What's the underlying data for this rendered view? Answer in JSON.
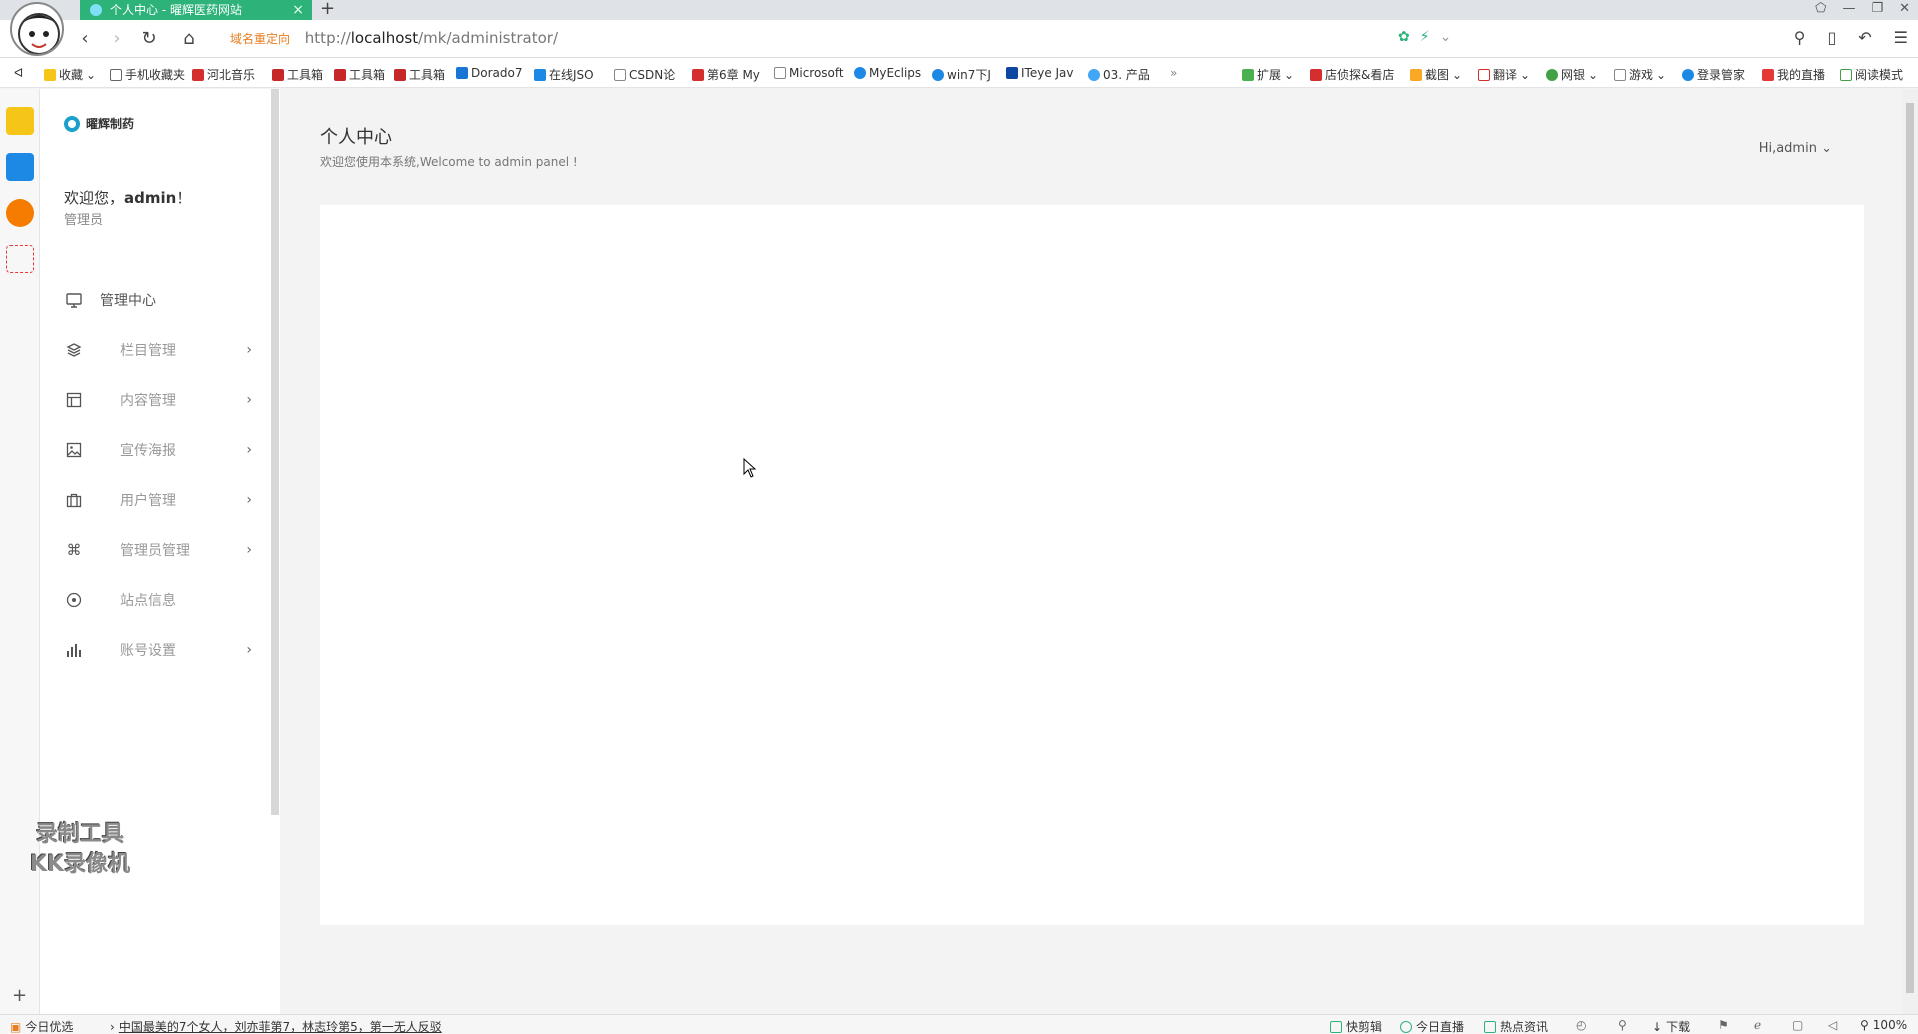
{
  "browser": {
    "tab_title": "个人中心 - 曜辉医药网站",
    "redirect_label": "域名重定向",
    "url_prefix": "http://",
    "url_host": "localhost",
    "url_path": "/mk/administrator/",
    "bookmarks": [
      "收藏",
      "手机收藏夹",
      "河北音乐",
      "工具箱",
      "工具箱",
      "工具箱",
      "Dorado7",
      "在线JSO",
      "CSDN论",
      "第6章 My",
      "Microsoft",
      "MyEclips",
      "win7下J",
      "ITeye Jav",
      "03. 产品"
    ],
    "bookmarks_right": [
      "扩展",
      "店侦探&看店",
      "截图",
      "翻译",
      "网银",
      "游戏",
      "登录管家",
      "我的直播",
      "阅读模式"
    ],
    "more": "»"
  },
  "sidebar": {
    "logo_text": "曜辉制药",
    "welcome_prefix": "欢迎您，",
    "welcome_user": "admin",
    "welcome_suffix": "！",
    "role": "管理员",
    "menu": [
      {
        "label": "管理中心",
        "icon": "monitor-icon"
      },
      {
        "label": "栏目管理",
        "icon": "layers-icon"
      },
      {
        "label": "内容管理",
        "icon": "layout-icon"
      },
      {
        "label": "宣传海报",
        "icon": "image-icon"
      },
      {
        "label": "用户管理",
        "icon": "briefcase-icon"
      },
      {
        "label": "管理员管理",
        "icon": "command-icon"
      },
      {
        "label": "站点信息",
        "icon": "target-icon"
      },
      {
        "label": "账号设置",
        "icon": "bar-chart-icon"
      }
    ],
    "watermark_line1": "录制工具",
    "watermark_line2": "KK录像机"
  },
  "main": {
    "title": "个人中心",
    "subtitle": "欢迎您使用本系统,Welcome to admin panel !",
    "user_menu": "Hi,admin"
  },
  "statusbar": {
    "daily": "今日优选",
    "news": "中国最美的7个女人，刘亦菲第7，林志玲第5，第一无人反驳",
    "quick_cut": "快剪辑",
    "live": "今日直播",
    "hot_news": "热点资讯",
    "download": "下载",
    "zoom": "100%"
  }
}
